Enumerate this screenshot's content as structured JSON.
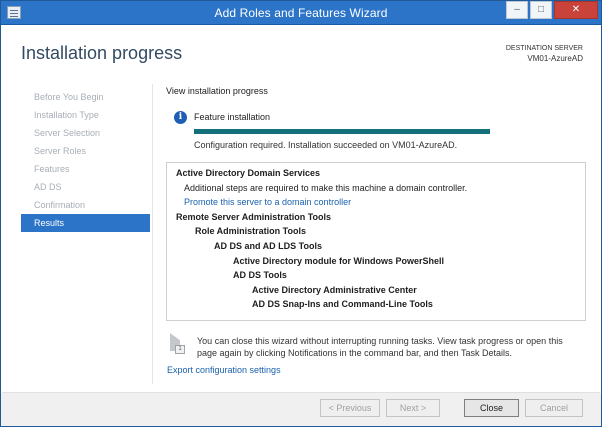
{
  "window": {
    "title": "Add Roles and Features Wizard",
    "controls": {
      "minimize": "–",
      "maximize": "□",
      "close": "✕"
    },
    "accent_color": "#2b74c7"
  },
  "header": {
    "title": "Installation progress",
    "destination_label": "DESTINATION SERVER",
    "destination_server": "VM01-AzureAD"
  },
  "sidebar": {
    "items": [
      {
        "label": "Before You Begin",
        "active": false
      },
      {
        "label": "Installation Type",
        "active": false
      },
      {
        "label": "Server Selection",
        "active": false
      },
      {
        "label": "Server Roles",
        "active": false
      },
      {
        "label": "Features",
        "active": false
      },
      {
        "label": "AD DS",
        "active": false
      },
      {
        "label": "Confirmation",
        "active": false
      },
      {
        "label": "Results",
        "active": true
      }
    ]
  },
  "main": {
    "view_label": "View installation progress",
    "info_icon": "info-icon",
    "feature_title": "Feature installation",
    "progress_fraction": 1.0,
    "status_text": "Configuration required. Installation succeeded on VM01-AzureAD.",
    "results": [
      {
        "text": "Active Directory Domain Services",
        "level": 0,
        "style": "bold"
      },
      {
        "text": "Additional steps are required to make this machine a domain controller.",
        "level": 1,
        "style": "normal"
      },
      {
        "text": "Promote this server to a domain controller",
        "level": 1,
        "style": "link"
      },
      {
        "text": "Remote Server Administration Tools",
        "level": 0,
        "style": "bold"
      },
      {
        "text": "Role Administration Tools",
        "level": 2,
        "style": "bold"
      },
      {
        "text": "AD DS and AD LDS Tools",
        "level": 3,
        "style": "bold"
      },
      {
        "text": "Active Directory module for Windows PowerShell",
        "level": 4,
        "style": "bold"
      },
      {
        "text": "AD DS Tools",
        "level": 4,
        "style": "bold"
      },
      {
        "text": "Active Directory Administrative Center",
        "level": 5,
        "style": "bold"
      },
      {
        "text": "AD DS Snap-Ins and Command-Line Tools",
        "level": 5,
        "style": "bold"
      }
    ],
    "notification_badge": "1",
    "note_text": "You can close this wizard without interrupting running tasks. View task progress or open this page again by clicking Notifications in the command bar, and then Task Details.",
    "export_link": "Export configuration settings"
  },
  "footer": {
    "previous": "< Previous",
    "next": "Next >",
    "close": "Close",
    "cancel": "Cancel"
  }
}
